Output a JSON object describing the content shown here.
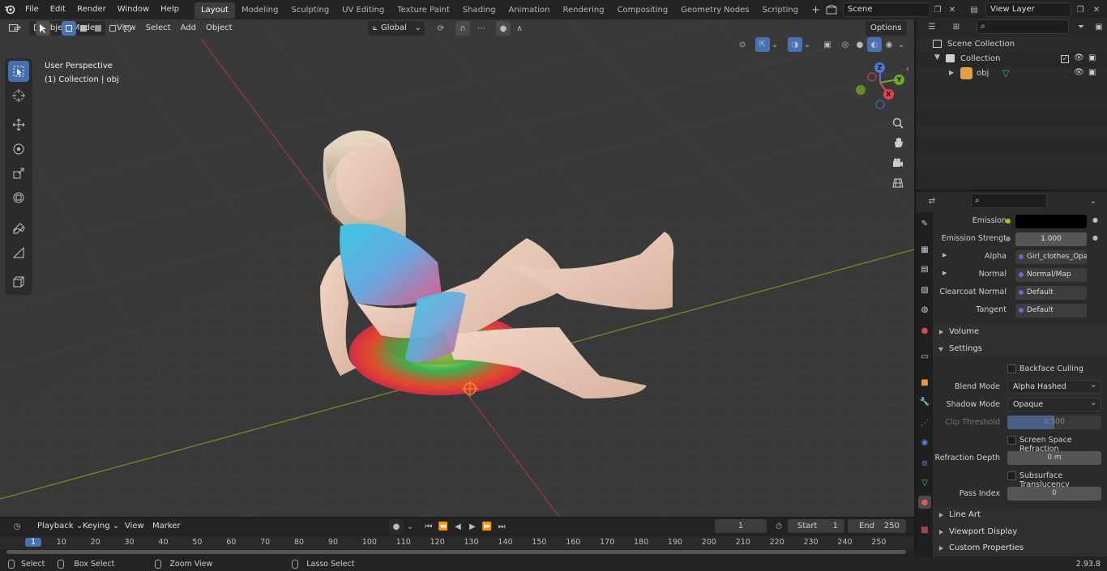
{
  "topbar": {
    "menus": [
      "File",
      "Edit",
      "Render",
      "Window",
      "Help"
    ],
    "workspaces": [
      "Layout",
      "Modeling",
      "Sculpting",
      "UV Editing",
      "Texture Paint",
      "Shading",
      "Animation",
      "Rendering",
      "Compositing",
      "Geometry Nodes",
      "Scripting"
    ],
    "active_workspace": "Layout",
    "add_tab": "+",
    "scene": "Scene",
    "view_layer": "View Layer"
  },
  "viewport": {
    "mode": "Object Mode",
    "menus": [
      "View",
      "Select",
      "Add",
      "Object"
    ],
    "transform_orientation": "Global",
    "options": "Options",
    "overlay_line1": "User Perspective",
    "overlay_line2": "(1) Collection | obj",
    "gizmo": {
      "z": "Z",
      "y": "Y",
      "x": "X"
    }
  },
  "outliner": {
    "root": "Scene Collection",
    "collection": "Collection",
    "object": "obj"
  },
  "properties": {
    "rows": [
      {
        "label": "Emission",
        "value": "",
        "dot": "#c7b600"
      },
      {
        "label": "Emission Strengt",
        "value": "1.000",
        "dot": "#888"
      },
      {
        "label": "Alpha",
        "value": "Girl_clothes_Opacity...",
        "dot": "#6a6ad6"
      },
      {
        "label": "Normal",
        "value": "Normal/Map",
        "dot": "#6a6ad6"
      },
      {
        "label": "Clearcoat Normal",
        "value": "Default",
        "dot": "#6a6ad6"
      },
      {
        "label": "Tangent",
        "value": "Default",
        "dot": "#6a6ad6"
      }
    ],
    "volume": "Volume",
    "settings": "Settings",
    "backface_culling": "Backface Culling",
    "blend_mode_label": "Blend Mode",
    "blend_mode": "Alpha Hashed",
    "shadow_mode_label": "Shadow Mode",
    "shadow_mode": "Opaque",
    "clip_threshold_label": "Clip Threshold",
    "clip_threshold": "0.500",
    "clip_threshold_fraction": 0.5,
    "ssr": "Screen Space Refraction",
    "refraction_depth_label": "Refraction Depth",
    "refraction_depth": "0 m",
    "subsurface": "Subsurface Translucency",
    "pass_index_label": "Pass Index",
    "pass_index": "0",
    "line_art": "Line Art",
    "viewport_display": "Viewport Display",
    "custom_properties": "Custom Properties"
  },
  "timeline": {
    "menus": [
      "Playback",
      "Keying",
      "View",
      "Marker"
    ],
    "current_frame": "1",
    "start_label": "Start",
    "start": "1",
    "end_label": "End",
    "end": "250",
    "ruler": [
      "1",
      "10",
      "20",
      "30",
      "40",
      "50",
      "60",
      "70",
      "80",
      "90",
      "100",
      "110",
      "120",
      "130",
      "140",
      "150",
      "160",
      "170",
      "180",
      "190",
      "200",
      "210",
      "220",
      "230",
      "240",
      "250"
    ]
  },
  "status": {
    "select": "Select",
    "box_select": "Box Select",
    "zoom_view": "Zoom View",
    "lasso_select": "Lasso Select",
    "version": "2.93.8"
  }
}
